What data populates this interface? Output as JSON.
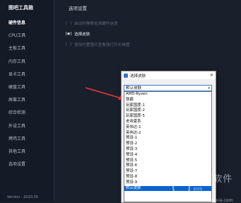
{
  "app": {
    "title": "图吧工具箱",
    "version": "Version : 2020.05"
  },
  "sidebar": {
    "items": [
      {
        "label": "硬件信息"
      },
      {
        "label": "CPU工具"
      },
      {
        "label": "主板工具"
      },
      {
        "label": "内存工具"
      },
      {
        "label": "显卡工具"
      },
      {
        "label": "硬盘工具"
      },
      {
        "label": "屏幕工具"
      },
      {
        "label": "综合检测"
      },
      {
        "label": "外设工具"
      },
      {
        "label": "烤鸡工具"
      },
      {
        "label": "其他工具"
      },
      {
        "label": "选项设置"
      }
    ]
  },
  "main": {
    "title": "选项设置",
    "options": [
      {
        "mark": "[ ]",
        "label": "启动时静默检测硬件信息"
      },
      {
        "mark": "[●]",
        "label": "选择皮肤"
      },
      {
        "mark": "[ ]",
        "label": "使用内置图片查看器打开天梯图"
      }
    ]
  },
  "dialog": {
    "title": "选择皮肤",
    "close": "✕",
    "selected": "默认皮肤",
    "options": [
      "AMD-Ryzen",
      "铁霸",
      "玩家国度-1",
      "玩家国度-2",
      "玩家国度-5",
      "老帝夏系",
      "英伟达-1",
      "英伟达-2",
      "预设-1",
      "预设-2",
      "预设-3",
      "预设-4",
      "预设-5",
      "预设-6",
      "预设-7",
      "预设-8",
      "预设-9",
      "默认皮肤"
    ]
  },
  "watermark": {
    "title": "当下软件园",
    "url": "www.downxia.com"
  },
  "colors": {
    "accent": "#0a64d0",
    "arrow": "#e23a3a"
  }
}
